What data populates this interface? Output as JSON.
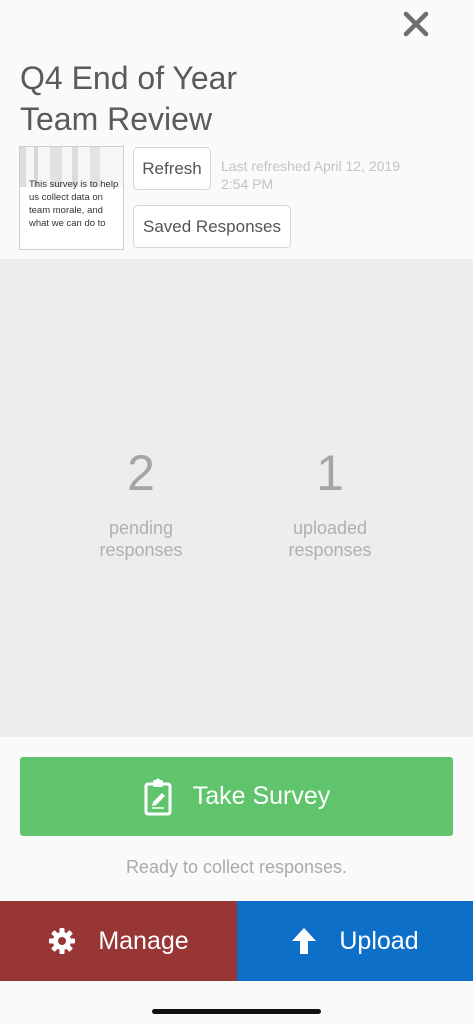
{
  "header": {
    "close_icon": "close-icon",
    "title_line1": "Q4 End of Year",
    "title_line2": "Team Review"
  },
  "survey": {
    "thumbnail_text": "This survey is to help us collect data on team morale, and what we can do to",
    "refresh_label": "Refresh",
    "saved_responses_label": "Saved Responses",
    "last_refreshed_line1": "Last refreshed April 12, 2019",
    "last_refreshed_line2": "2:54 PM"
  },
  "stats": {
    "pending": {
      "count": "2",
      "label_line1": "pending",
      "label_line2": "responses"
    },
    "uploaded": {
      "count": "1",
      "label_line1": "uploaded",
      "label_line2": "responses"
    }
  },
  "actions": {
    "take_survey_label": "Take Survey",
    "take_survey_icon": "clipboard-edit-icon",
    "status_text": "Ready to collect responses.",
    "manage_label": "Manage",
    "manage_icon": "gear-icon",
    "upload_label": "Upload",
    "upload_icon": "arrow-up-icon"
  },
  "colors": {
    "take_survey": "#5fc46c",
    "manage": "#983636",
    "upload": "#0e6fc8"
  }
}
